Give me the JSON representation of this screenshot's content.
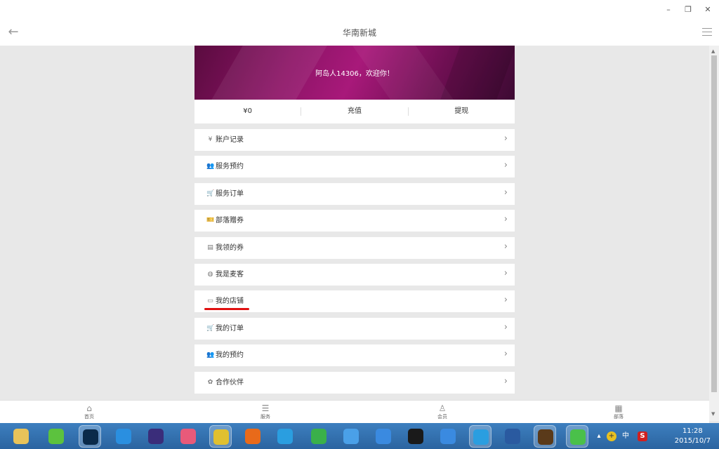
{
  "window": {
    "minimize_glyph": "–",
    "restore_glyph": "❐",
    "close_glyph": "✕"
  },
  "appbar": {
    "title": "华南新城",
    "back_icon": "back-arrow-icon",
    "menu_icon": "hamburger-menu-icon"
  },
  "banner": {
    "welcome": "阿岛人14306，欢迎你！"
  },
  "wallet": {
    "balance": "¥0",
    "recharge": "充值",
    "withdraw": "提现"
  },
  "menu": {
    "items": [
      {
        "label": "账户记录",
        "icon": "yen-icon",
        "glyph": "¥"
      },
      {
        "label": "服务预约",
        "icon": "users-icon",
        "glyph": "👥"
      },
      {
        "label": "服务订单",
        "icon": "cart-icon",
        "glyph": "🛒"
      },
      {
        "label": "部落赠券",
        "icon": "ticket-icon",
        "glyph": "🎫"
      },
      {
        "label": "我领的券",
        "icon": "coupon-icon",
        "glyph": "▤"
      },
      {
        "label": "我是麦客",
        "icon": "globe-icon",
        "glyph": "◍"
      },
      {
        "label": "我的店铺",
        "icon": "store-icon",
        "glyph": "▭"
      },
      {
        "label": "我的订单",
        "icon": "cart-icon",
        "glyph": "🛒"
      },
      {
        "label": "我的预约",
        "icon": "users-icon",
        "glyph": "👥"
      },
      {
        "label": "合作伙伴",
        "icon": "flame-icon",
        "glyph": "✿"
      }
    ],
    "chevron": "›"
  },
  "tabbar": {
    "tabs": [
      {
        "label": "首页",
        "icon": "home-icon",
        "glyph": "⌂"
      },
      {
        "label": "服务",
        "icon": "list-icon",
        "glyph": "☰"
      },
      {
        "label": "会员",
        "icon": "user-icon",
        "glyph": "♙"
      },
      {
        "label": "部落",
        "icon": "grid-icon",
        "glyph": "▦"
      }
    ]
  },
  "taskbar": {
    "apps": [
      {
        "name": "file-explorer-icon",
        "color": "#e8c35a"
      },
      {
        "name": "green-app-icon",
        "color": "#5cc23e"
      },
      {
        "name": "photoshop-icon",
        "color": "#0a2a4a"
      },
      {
        "name": "kugou-icon",
        "color": "#2a8fe0"
      },
      {
        "name": "eclipse-icon",
        "color": "#3a2d7a"
      },
      {
        "name": "colorful-app-icon",
        "color": "#e85a7a"
      },
      {
        "name": "chrome-icon",
        "color": "#e0c030"
      },
      {
        "name": "firefox-icon",
        "color": "#e86a1a"
      },
      {
        "name": "ie-icon",
        "color": "#2a9ee0"
      },
      {
        "name": "download-icon",
        "color": "#3ab04a"
      },
      {
        "name": "cloud-icon",
        "color": "#4aa0e8"
      },
      {
        "name": "baidu-cloud-icon",
        "color": "#3a8ae0"
      },
      {
        "name": "eye-app-icon",
        "color": "#1a1a1a"
      },
      {
        "name": "pen-app-icon",
        "color": "#3a8ae0"
      },
      {
        "name": "ie-icon-2",
        "color": "#2a9ee0"
      },
      {
        "name": "word-icon",
        "color": "#2a5aa0"
      },
      {
        "name": "game-icon",
        "color": "#5a3a1a"
      },
      {
        "name": "wechat-icon",
        "color": "#4ac04a"
      }
    ],
    "tray": {
      "expand": "▴",
      "lang": "中",
      "ime": "S"
    },
    "time": "11:28",
    "date": "2015/10/7"
  }
}
